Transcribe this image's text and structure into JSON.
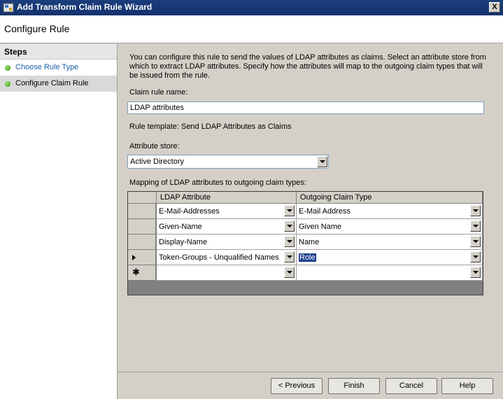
{
  "window": {
    "title": "Add Transform Claim Rule Wizard",
    "close_glyph": "X"
  },
  "header": {
    "title": "Configure Rule"
  },
  "steps": {
    "heading": "Steps",
    "items": [
      {
        "label": "Choose Rule Type"
      },
      {
        "label": "Configure Claim Rule"
      }
    ]
  },
  "main": {
    "description": "You can configure this rule to send the values of LDAP attributes as claims. Select an attribute store from which to extract LDAP attributes. Specify how the attributes will map to the outgoing claim types that will be issued from the rule.",
    "claim_rule_name_label": "Claim rule name:",
    "claim_rule_name_value": "LDAP attributes",
    "rule_template": "Rule template: Send LDAP Attributes as Claims",
    "attribute_store_label": "Attribute store:",
    "attribute_store_value": "Active Directory",
    "mapping_label": "Mapping of LDAP attributes to outgoing claim types:",
    "grid": {
      "columns": [
        "LDAP Attribute",
        "Outgoing Claim Type"
      ],
      "rows": [
        {
          "ldap": "E-Mail-Addresses",
          "claim": "E-Mail Address"
        },
        {
          "ldap": "Given-Name",
          "claim": "Given Name"
        },
        {
          "ldap": "Display-Name",
          "claim": "Name"
        },
        {
          "ldap": "Token-Groups - Unqualified Names",
          "claim": "Role"
        },
        {
          "ldap": "",
          "claim": ""
        }
      ],
      "new_row_glyph": "✱"
    }
  },
  "footer": {
    "previous": "< Previous",
    "finish": "Finish",
    "cancel": "Cancel",
    "help": "Help"
  }
}
